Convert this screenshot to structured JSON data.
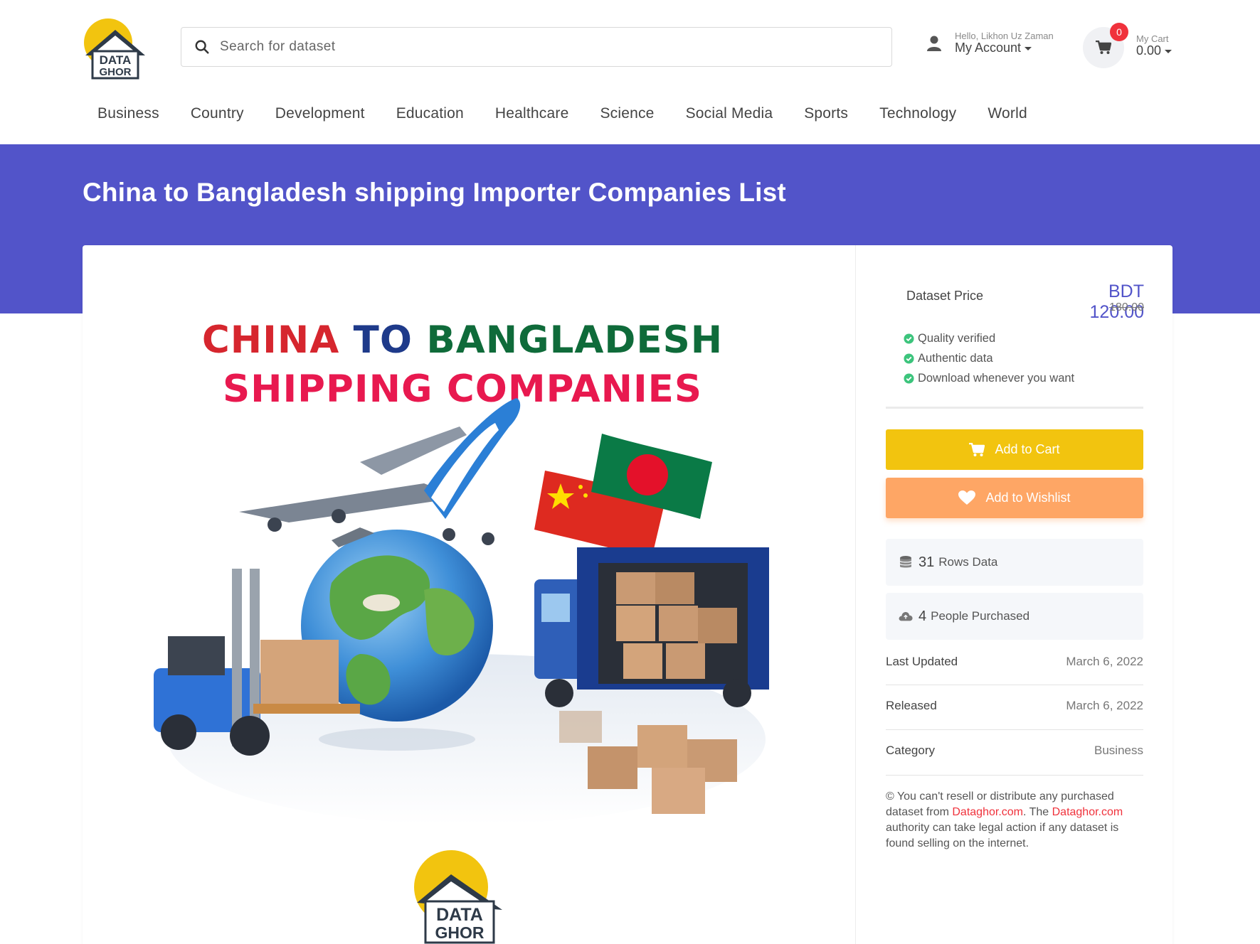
{
  "header": {
    "logo_text_top": "DATA",
    "logo_text_bottom": "GHOR",
    "search_placeholder": "Search for dataset",
    "account": {
      "greeting": "Hello, Likhon Uz Zaman",
      "label": "My Account"
    },
    "cart": {
      "badge": "0",
      "label": "My Cart",
      "amount": "0.00"
    }
  },
  "nav": {
    "items": [
      "Business",
      "Country",
      "Development",
      "Education",
      "Healthcare",
      "Science",
      "Social Media",
      "Sports",
      "Technology",
      "World"
    ]
  },
  "page": {
    "title": "China to Bangladesh shipping Importer Companies List"
  },
  "hero": {
    "line1_word1": "CHINA",
    "line1_word2": "TO",
    "line1_word3": "BANGLADESH",
    "line2": "SHIPPING COMPANIES",
    "logo_text_top": "DATA",
    "logo_text_bottom": "GHOR"
  },
  "sidebar": {
    "price_label": "Dataset Price",
    "price": "BDT 120.00",
    "old_price": "180.00",
    "features": [
      "Quality verified",
      "Authentic data",
      "Download whenever you want"
    ],
    "add_to_cart": "Add to Cart",
    "add_to_wishlist": "Add to Wishlist",
    "rows_count": "31",
    "rows_label": "Rows Data",
    "purchased_count": "4",
    "purchased_label": "People Purchased",
    "meta": [
      {
        "key": "Last Updated",
        "value": "March 6, 2022"
      },
      {
        "key": "Released",
        "value": "March 6, 2022"
      },
      {
        "key": "Category",
        "value": "Business"
      }
    ],
    "notice": {
      "part1": "© You can't resell or distribute any purchased dataset from ",
      "link1": "Dataghor.com",
      "part2": ". The ",
      "link2": "Dataghor.com",
      "part3": " authority can take legal action if any dataset is found selling on the internet."
    }
  },
  "colors": {
    "banner": "#5254c9",
    "cart_button": "#f2c40f",
    "wishlist_button": "#fea665",
    "badge": "#f0323c",
    "check": "#3cc47c",
    "hero_red": "#d6262e",
    "hero_blue": "#1e3a8a",
    "hero_green": "#0f6b3a",
    "hero_pink": "#e8194f"
  },
  "icons": [
    "search-icon",
    "user-icon",
    "cart-icon",
    "check-circle-icon",
    "heart-icon",
    "database-icon",
    "cloud-icon"
  ]
}
